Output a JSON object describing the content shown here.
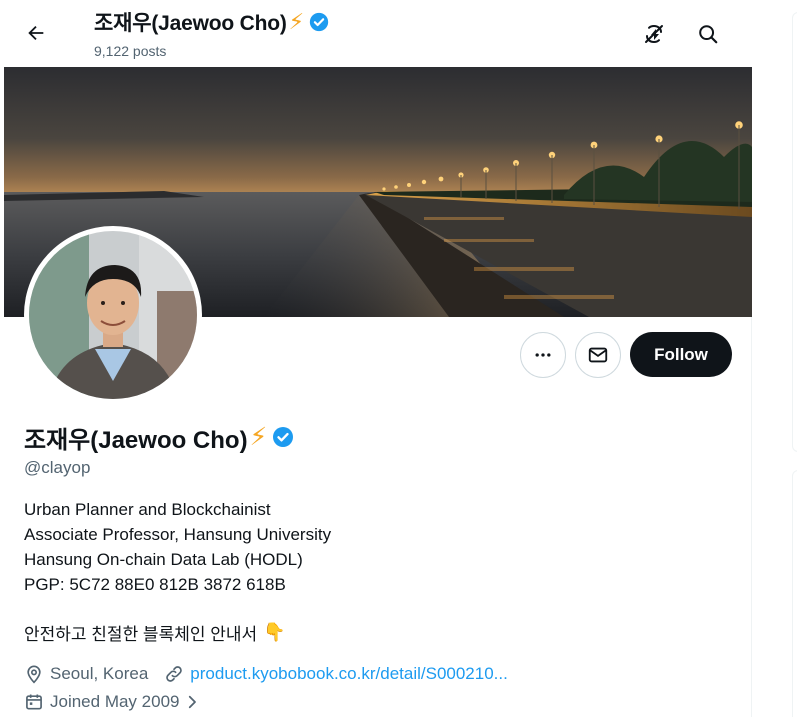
{
  "header": {
    "title": "조재우(Jaewoo Cho)",
    "posts": "9,122 posts"
  },
  "profile": {
    "name": "조재우(Jaewoo Cho)",
    "handle": "@clayop",
    "bio_lines": [
      "Urban Planner and Blockchainist",
      "Associate Professor, Hansung University",
      "Hansung On-chain Data Lab (HODL)",
      "PGP: 5C72 88E0 812B 3872 618B"
    ],
    "bio_korean": "안전하고 친절한 블록체인 안내서",
    "location": "Seoul, Korea",
    "website": "product.kyobobook.co.kr/detail/S000210...",
    "joined": "Joined May 2009"
  },
  "actions": {
    "follow_label": "Follow"
  },
  "icons": {
    "back": "back-arrow-icon",
    "premium": "no-premium-icon",
    "search": "search-icon",
    "verified": "verified-badge-icon",
    "more": "more-icon",
    "message": "message-icon",
    "location": "location-icon",
    "link": "link-icon",
    "calendar": "calendar-icon",
    "chevron": "chevron-right-icon"
  },
  "colors": {
    "accent": "#1d9bf0",
    "text": "#0f1419",
    "muted": "#536471",
    "bolt": "#f5a623"
  }
}
